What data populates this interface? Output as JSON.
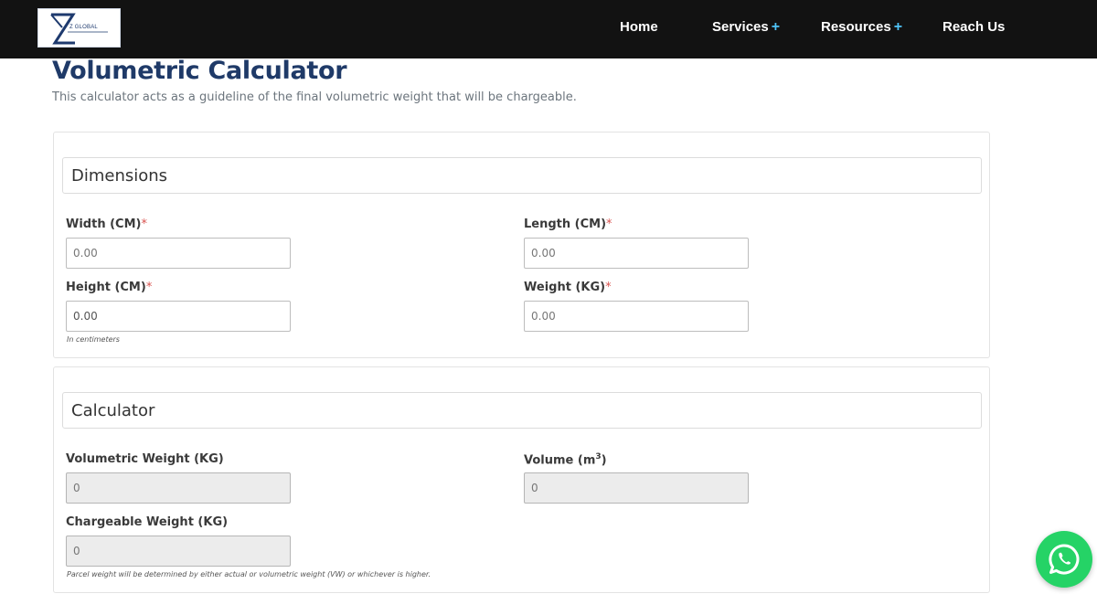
{
  "header": {
    "logo_text": "Z GLOBAL",
    "nav": {
      "home": "Home",
      "services": "Services",
      "resources": "Resources",
      "reach_us": "Reach Us",
      "plus": "+"
    }
  },
  "page": {
    "title": "Volumetric Calculator",
    "subtitle": "This calculator acts as a guideline of the final volumetric weight that will be chargeable."
  },
  "dimensions": {
    "heading": "Dimensions",
    "width_label": "Width (CM)",
    "length_label": "Length (CM)",
    "height_label": "Height (CM)",
    "weight_label": "Weight (KG)",
    "required_mark": "*",
    "width_value": "0.00",
    "length_placeholder": "0.00",
    "height_value": "0.00",
    "weight_placeholder": "0.00",
    "width_placeholder": "0.00",
    "height_help": "In centimeters"
  },
  "calculator": {
    "heading": "Calculator",
    "volumetric_label": "Volumetric Weight (KG)",
    "volume_label": "Volume (m",
    "volume_label_sup": "3",
    "volume_label_end": ")",
    "chargeable_label": "Chargeable Weight (KG)",
    "volumetric_value": "0",
    "volume_value": "0",
    "chargeable_value": "0",
    "note": "Parcel weight will be determined by either actual or volumetric weight (VW) or whichever is higher."
  },
  "icons": {
    "whatsapp": "whatsapp-icon",
    "whatsapp_color": "#25d366",
    "accent": "#1f3a68"
  }
}
